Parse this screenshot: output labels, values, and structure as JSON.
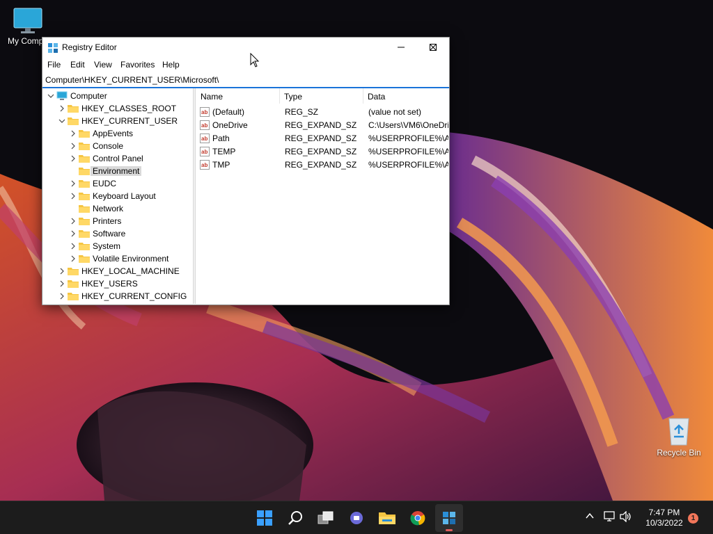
{
  "desktop": {
    "icons": [
      {
        "label": "My Compu"
      },
      {
        "label": "Recycle Bin"
      }
    ]
  },
  "window": {
    "title": "Registry Editor",
    "menu": [
      "File",
      "Edit",
      "View",
      "Favorites",
      "Help"
    ],
    "address": "Computer\\HKEY_CURRENT_USER\\Microsoft\\",
    "tree": [
      {
        "label": "Computer",
        "level": 0,
        "expanded": true
      },
      {
        "label": "HKEY_CLASSES_ROOT",
        "level": 1,
        "expanded": false
      },
      {
        "label": "HKEY_CURRENT_USER",
        "level": 1,
        "expanded": true
      },
      {
        "label": "AppEvents",
        "level": 2,
        "expanded": false
      },
      {
        "label": "Console",
        "level": 2,
        "expanded": false
      },
      {
        "label": "Control Panel",
        "level": 2,
        "expanded": false
      },
      {
        "label": "Environment",
        "level": 2,
        "expanded": false,
        "selected": true,
        "leaf": true
      },
      {
        "label": "EUDC",
        "level": 2,
        "expanded": false
      },
      {
        "label": "Keyboard Layout",
        "level": 2,
        "expanded": false
      },
      {
        "label": "Network",
        "level": 2,
        "expanded": false,
        "leaf": true
      },
      {
        "label": "Printers",
        "level": 2,
        "expanded": false
      },
      {
        "label": "Software",
        "level": 2,
        "expanded": false
      },
      {
        "label": "System",
        "level": 2,
        "expanded": false
      },
      {
        "label": "Volatile Environment",
        "level": 2,
        "expanded": false
      },
      {
        "label": "HKEY_LOCAL_MACHINE",
        "level": 1,
        "expanded": false
      },
      {
        "label": "HKEY_USERS",
        "level": 1,
        "expanded": false
      },
      {
        "label": "HKEY_CURRENT_CONFIG",
        "level": 1,
        "expanded": false
      }
    ],
    "columns": [
      "Name",
      "Type",
      "Data"
    ],
    "values": [
      {
        "name": "(Default)",
        "type": "REG_SZ",
        "data": "(value not set)"
      },
      {
        "name": "OneDrive",
        "type": "REG_EXPAND_SZ",
        "data": "C:\\Users\\VM6\\OneDri"
      },
      {
        "name": "Path",
        "type": "REG_EXPAND_SZ",
        "data": "%USERPROFILE%\\App"
      },
      {
        "name": "TEMP",
        "type": "REG_EXPAND_SZ",
        "data": "%USERPROFILE%\\App"
      },
      {
        "name": "TMP",
        "type": "REG_EXPAND_SZ",
        "data": "%USERPROFILE%\\App"
      }
    ]
  },
  "taskbar": {
    "apps": [
      "start-icon",
      "search-icon",
      "task-view-icon",
      "chat-icon",
      "file-explorer-icon",
      "chrome-icon",
      "registry-editor-icon"
    ],
    "active_app": "registry-editor-icon",
    "time": "7:47 PM",
    "date": "10/3/2022",
    "notification_count": "1"
  },
  "colors": {
    "accent": "#1a73d9",
    "folder": "#f5c542",
    "notification": "#f2765a"
  }
}
